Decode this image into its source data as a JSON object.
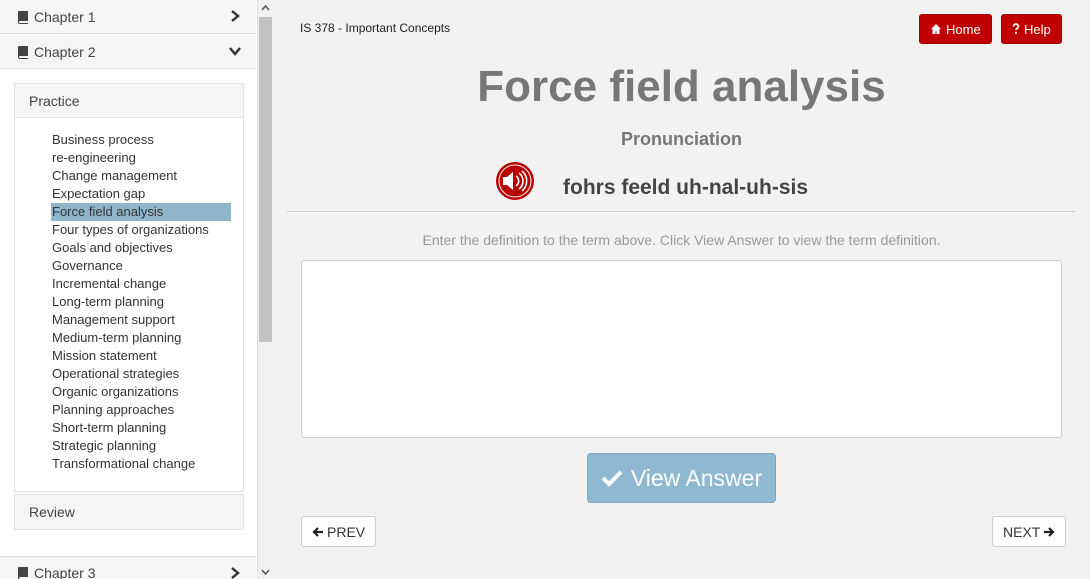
{
  "sidebar": {
    "chapters": [
      {
        "label": "Chapter 1",
        "state": "collapsed"
      },
      {
        "label": "Chapter 2",
        "state": "expanded"
      },
      {
        "label": "Chapter 3",
        "state": "collapsed"
      }
    ],
    "practice_label": "Practice",
    "review_label": "Review",
    "terms": [
      "Business process",
      "re-engineering",
      "Change management",
      "Expectation gap",
      "Force field analysis",
      "Four types of organizations",
      "Goals and objectives",
      "Governance",
      "Incremental change",
      "Long-term planning",
      "Management support",
      "Medium-term planning",
      "Mission statement",
      "Operational strategies",
      "Organic organizations",
      "Planning approaches",
      "Short-term planning",
      "Strategic planning",
      "Transformational change"
    ],
    "active_term": "Force field analysis"
  },
  "header": {
    "course_title": "IS 378 - Important Concepts",
    "home_label": "Home",
    "help_label": "Help"
  },
  "term": {
    "title": "Force field analysis",
    "pronunciation_label": "Pronunciation",
    "pronunciation": "fohrs feeld uh-nal-uh-sis"
  },
  "exercise": {
    "instruction": "Enter the definition to the term above. Click View Answer to view the term definition.",
    "answer_value": "",
    "view_answer_label": "View Answer"
  },
  "nav": {
    "prev_label": "PREV",
    "next_label": "NEXT"
  },
  "colors": {
    "accent_red": "#c00000",
    "active_highlight": "#8fb5cb",
    "view_button": "#8fb9d1"
  },
  "icons": {
    "chapter": "book-icon",
    "collapsed": "chevron-right-icon",
    "expanded": "chevron-down-icon",
    "home": "home-icon",
    "help": "question-icon",
    "audio": "speaker-icon",
    "check": "check-icon",
    "prev": "arrow-left-icon",
    "next": "arrow-right-icon"
  }
}
